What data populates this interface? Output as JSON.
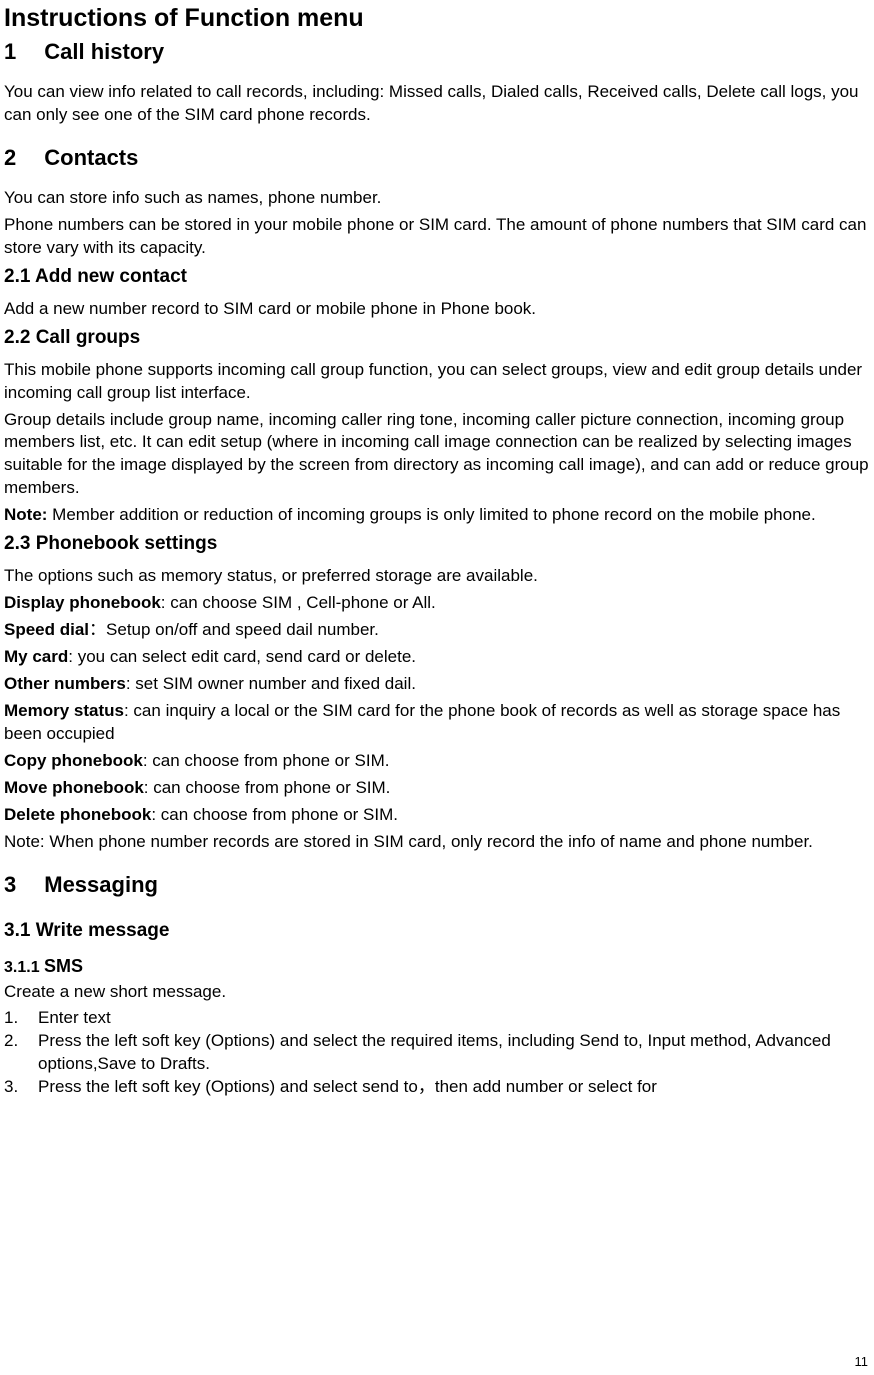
{
  "title": "Instructions of Function menu",
  "s1": {
    "heading_num": "1",
    "heading_txt": "Call history",
    "p1": "You can view info related to call records, including: Missed calls, Dialed calls, Received calls, Delete call logs, you can only see one of the SIM card phone records."
  },
  "s2": {
    "heading_num": "2",
    "heading_txt": "Contacts",
    "p1": "You can store info such as names, phone number.",
    "p2": "Phone numbers can be stored in your mobile phone or SIM card. The amount of phone numbers that SIM card can store vary with its capacity.",
    "s21": {
      "heading": "2.1 Add new contact",
      "p1": "Add a new number record to SIM card or mobile phone in Phone book."
    },
    "s22": {
      "heading": "2.2 Call groups",
      "p1": "This mobile phone supports incoming call group function, you can select groups, view and edit group details under incoming call group list interface.",
      "p2": "Group details include group name, incoming caller ring tone, incoming caller picture connection, incoming group members list, etc. It can edit setup (where in incoming call image connection can be realized by selecting images suitable for the image displayed by the screen from directory as incoming call image), and can add or reduce group members.",
      "note_b": "Note:",
      "note_t": " Member addition or reduction of incoming groups is only limited to phone record on the mobile phone."
    },
    "s23": {
      "heading": "2.3 Phonebook settings",
      "p1": "The options such as memory status, or preferred storage are available.",
      "opt1_b": "Display phonebook",
      "opt1_t": ": can choose SIM , Cell-phone or All.",
      "opt2_b": "Speed dial",
      "opt2_t": "：Setup on/off and speed dail number.",
      "opt3_b": "My card",
      "opt3_t": ": you can select edit card, send card or delete.",
      "opt4_b": "Other numbers",
      "opt4_t": ": set SIM owner number and fixed dail.",
      "opt5_b": "Memory status",
      "opt5_t": ": can inquiry a local or the SIM card for the phone book of records as well as storage space has been occupied",
      "opt6_b": "Copy phonebook",
      "opt6_t": ": can choose from phone or SIM.",
      "opt7_b": "Move phonebook",
      "opt7_t": ": can choose from phone or SIM.",
      "opt8_b": "Delete phonebook",
      "opt8_t": ": can choose from phone or SIM.",
      "pnote": "Note: When phone number records are stored in SIM card, only record the info of name and phone number."
    }
  },
  "s3": {
    "heading_num": "3",
    "heading_txt": "Messaging",
    "s31": {
      "heading": "3.1 Write message",
      "s311": {
        "heading_pre": "3.1.1 ",
        "heading_b": "SMS",
        "p1": "Create a new short message.",
        "li1_n": "1.",
        "li1_t": "Enter text",
        "li2_n": "2.",
        "li2_t": "Press the left soft key (Options) and select the required items, including Send to, Input method, Advanced options,Save to Drafts.",
        "li3_n": "3.",
        "li3_t": "Press the left soft key (Options) and select send to，then add number or select for"
      }
    }
  },
  "page_number": "11"
}
